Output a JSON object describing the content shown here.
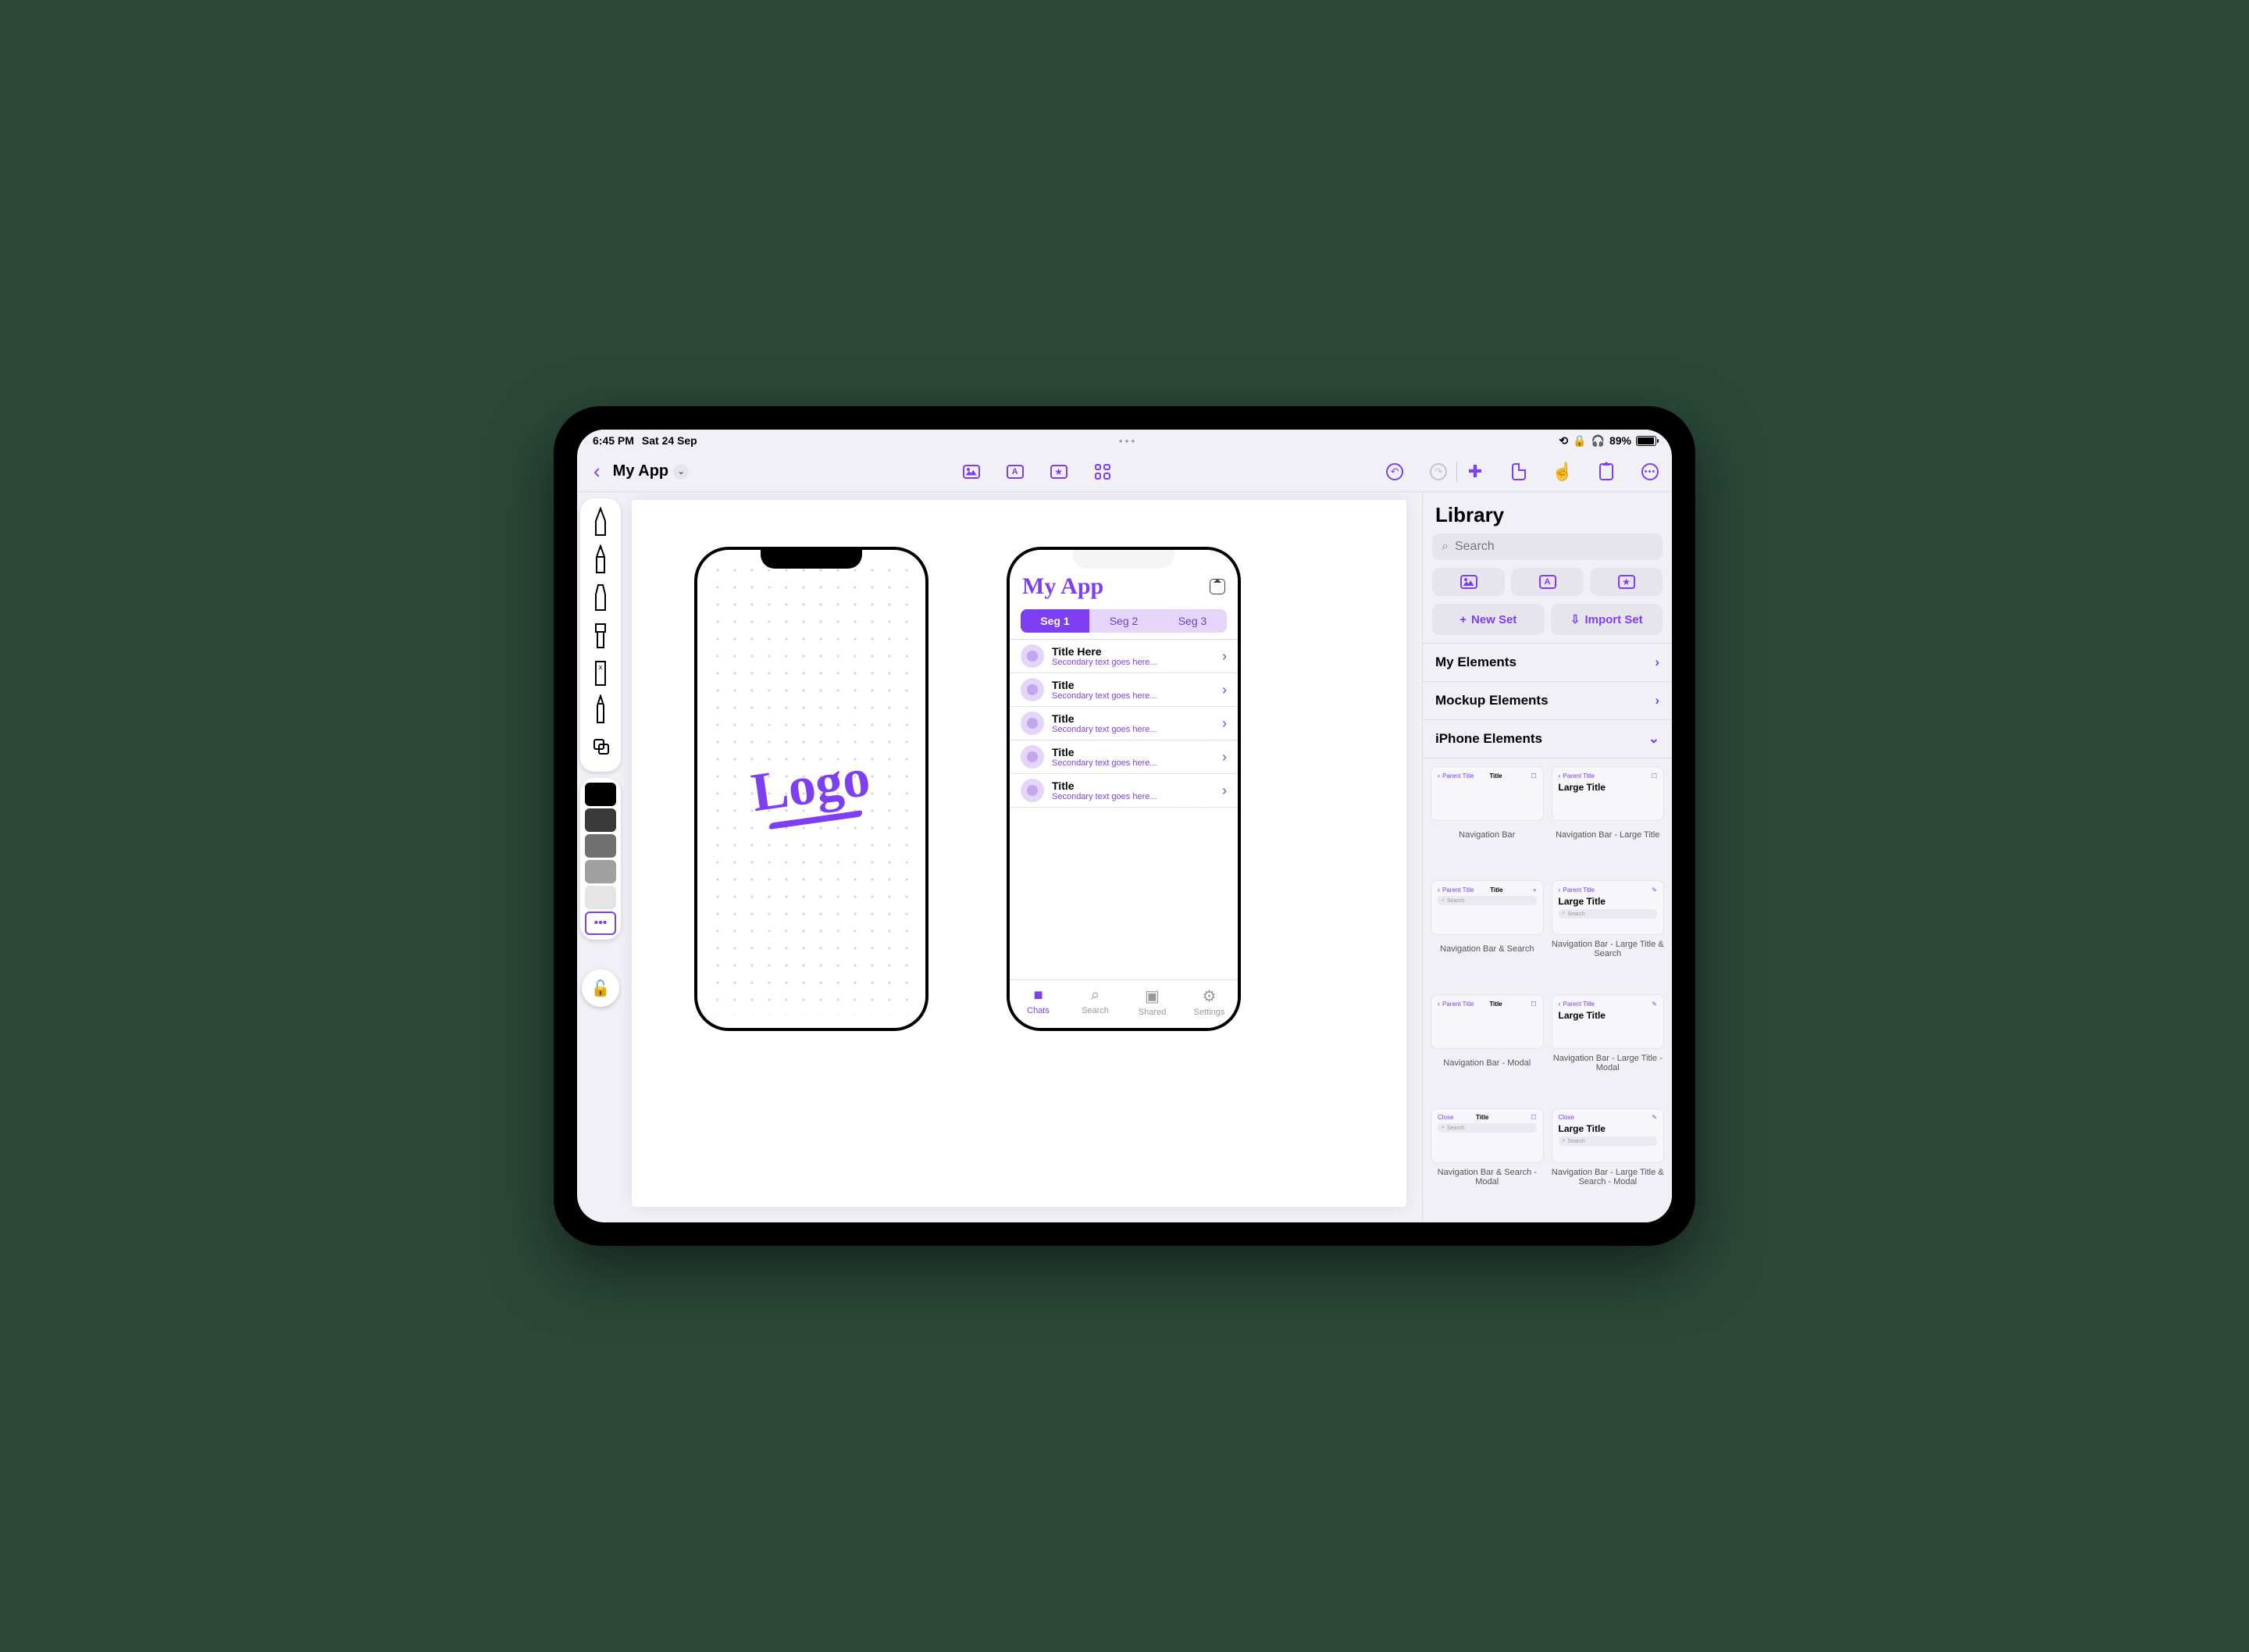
{
  "status": {
    "time": "6:45 PM",
    "date": "Sat 24 Sep",
    "battery": "89%"
  },
  "toolbar": {
    "doc_title": "My App"
  },
  "canvas": {
    "logo_text": "Logo",
    "phone2": {
      "title": "My App",
      "segments": [
        "Seg 1",
        "Seg 2",
        "Seg 3"
      ],
      "rows": [
        {
          "title": "Title Here",
          "sub": "Secondary text goes here..."
        },
        {
          "title": "Title",
          "sub": "Secondary text goes here..."
        },
        {
          "title": "Title",
          "sub": "Secondary text goes here..."
        },
        {
          "title": "Title",
          "sub": "Secondary text goes here..."
        },
        {
          "title": "Title",
          "sub": "Secondary text goes here..."
        }
      ],
      "tabs": [
        {
          "label": "Chats",
          "icon": "■"
        },
        {
          "label": "Search",
          "icon": "⌕"
        },
        {
          "label": "Shared",
          "icon": "▣"
        },
        {
          "label": "Settings",
          "icon": "⚙"
        }
      ]
    }
  },
  "library": {
    "title": "Library",
    "search_placeholder": "Search",
    "new_set": "New Set",
    "import_set": "Import Set",
    "sections": {
      "my_elements": "My Elements",
      "mockup_elements": "Mockup Elements",
      "iphone_elements": "iPhone Elements"
    },
    "thumb_labels": {
      "parent": "Parent Title",
      "title": "Title",
      "large_title": "Large Title",
      "search": "Search",
      "close": "Close"
    },
    "items": [
      "Navigation Bar",
      "Navigation Bar - Large Title",
      "Navigation Bar & Search",
      "Navigation Bar - Large Title & Search",
      "Navigation Bar - Modal",
      "Navigation Bar - Large Title - Modal",
      "Navigation Bar & Search - Modal",
      "Navigation Bar - Large Title & Search - Modal"
    ]
  },
  "colors": {
    "swatches": [
      "#000000",
      "#3a3a3a",
      "#707070",
      "#a0a0a0",
      "#e5e5e5",
      "#ffffff"
    ]
  }
}
